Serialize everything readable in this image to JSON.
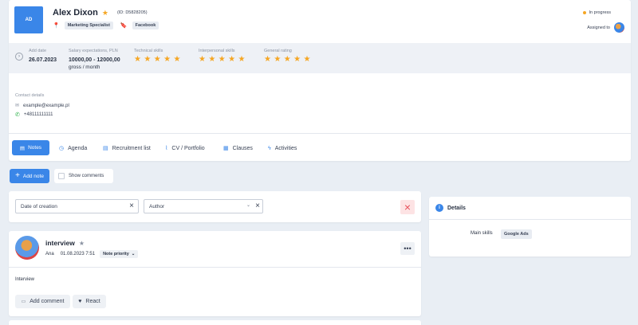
{
  "candidate": {
    "initials": "AD",
    "name": "Alex Dixon",
    "id_label": "(ID: D5828205)",
    "tags": [
      "Marketing Specialist",
      "Facebook"
    ],
    "status": "In progress",
    "assigned_label": "Assigned to"
  },
  "info": {
    "add_date_label": "Add date",
    "add_date": "26.07.2023",
    "salary_label": "Salary expectations, PLN",
    "salary_value": "10000,00 - 12000,00",
    "salary_unit": "gross / month",
    "technical_label": "Technical skills",
    "interpersonal_label": "Interpersonal skills",
    "general_label": "General rating",
    "technical_stars": 5,
    "interpersonal_stars": 5,
    "general_stars": 5
  },
  "contact": {
    "label": "Contact details",
    "email": "example@example.pl",
    "phone": "+48111111111"
  },
  "tabs": [
    "Notes",
    "Agenda",
    "Recruitment list",
    "CV / Portfolio",
    "Clauses",
    "Activities"
  ],
  "actions": {
    "add_note": "Add note",
    "show_comments": "Show comments"
  },
  "filters": {
    "date_placeholder": "Date of creation",
    "author_placeholder": "Author"
  },
  "note": {
    "title": "interview",
    "author": "Ana",
    "datetime": "01.08.2023 7:51",
    "priority": "Note priority",
    "body": "Interview",
    "add_comment": "Add comment",
    "react": "React"
  },
  "details": {
    "title": "Details",
    "main_skills_label": "Main skills",
    "main_skills_value": "Google Ads"
  },
  "colors": {
    "accent": "#3a86e8",
    "star": "#f5a623",
    "status": "#f5a623",
    "danger": "#e8505b"
  }
}
